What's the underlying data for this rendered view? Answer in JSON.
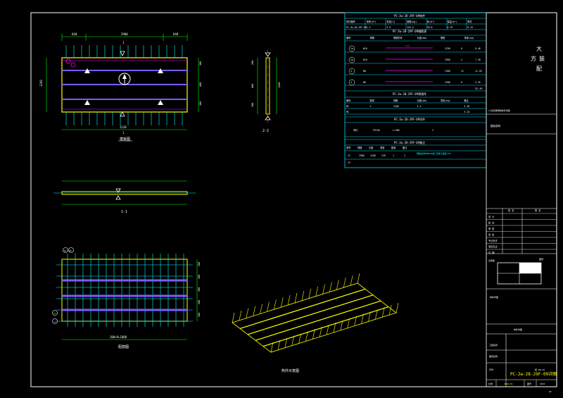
{
  "colors": {
    "frame": "#ffffff",
    "dim": "#00ff00",
    "table": "#00d7ff",
    "rebar": "#ffff00",
    "stirrup": "#00ffff",
    "beam": "#7b5cff",
    "cut": "#ff2020",
    "magenta": "#ff00ff",
    "text": "#ffffff",
    "title": "#ffff00"
  },
  "views": {
    "plan_label": "模板图",
    "side_label": "2-2",
    "section_label": "1-1",
    "rebar_plan_label": "配筋图",
    "iso_label": "构件示意图",
    "plan_dims": {
      "top_segments": [
        "640",
        "2900",
        "640"
      ],
      "bottom_total": "2120",
      "cut_mark": "1",
      "left_height": "1200",
      "right_vals": [
        "300",
        "600",
        "300"
      ]
    },
    "side_dims": [
      "200",
      "600",
      "200",
      "1200"
    ],
    "rebar_dims": {
      "bottom": "200×9=1800",
      "right": [
        "200",
        "200",
        "200",
        "200",
        "200"
      ]
    },
    "rebar_marks": [
      "1a",
      "2b",
      "3",
      "4"
    ]
  },
  "table": {
    "title": "PC-2w-28-29F-09构件",
    "header": [
      "构件编号",
      "体积(m³)",
      "重量(t)",
      "钢筋(kg)",
      "砼(m³)",
      "保温(m²)",
      "附件"
    ],
    "row": [
      "PC-2w-28-29F-09",
      "1.2",
      "2.9",
      "123.4",
      "95.0",
      "0.79",
      "0.15"
    ],
    "sub_title": "PC-2w-28-29F-09钢筋表",
    "sub_header": [
      "编号",
      "规格",
      "钢筋形状",
      "长度(mm)",
      "根数",
      "重量(kg)"
    ],
    "sub_rows": [
      [
        "1a",
        "Φ10",
        "1140",
        "2290",
        "6",
        "8.46"
      ],
      [
        "2b",
        "Φ10",
        "",
        "2960",
        "4",
        "7.30"
      ],
      [
        "3",
        "Φ8",
        "",
        "2380",
        "12",
        "11.28"
      ],
      [
        "4",
        "Φ8",
        "",
        "2300",
        "6",
        "5.45"
      ]
    ],
    "sub_total": "32.49",
    "embed_title": "PC-2w-28-29F-09预埋件",
    "embed_header": [
      "编号",
      "数量",
      "规格",
      "长度(mm)",
      "重量(kg)",
      "备注"
    ],
    "embed_rows": [
      [
        "M1",
        "2",
        "1200",
        "3.1",
        "",
        "4.16"
      ],
      [
        "M2",
        "",
        "",
        "",
        "",
        "5.24"
      ]
    ],
    "part_title": "PC-2w-28-29F-09吊件",
    "part_row": [
      "吊钉",
      "PVC40",
      "L=300",
      "",
      "2",
      "",
      ""
    ],
    "note_title": "PC-2w-28-29F-09备注",
    "note_header": [
      "型号",
      "规格",
      "长度",
      "重量",
      "数量",
      "备注"
    ],
    "note_rows": [
      [
        "J1",
        "2900",
        "1200",
        "120",
        "1",
        "1",
        "钢筋采用HRB400级,混凝土强度C30。"
      ],
      [
        "J2",
        "",
        "",
        "",
        "",
        "",
        ""
      ]
    ]
  },
  "titleblock": {
    "company": [
      "大",
      "方",
      "装",
      "配"
    ],
    "project_note": "xx住宅楼预制构件详图",
    "design_note": "图纸说明",
    "col_headers": [
      "姓 名",
      "签 名"
    ],
    "roles": [
      "设 计",
      "校 对",
      "审 核",
      "审 定",
      "专业负责",
      "项目负责",
      "日 期"
    ],
    "stamp_label": "注册章",
    "key_label": "图例",
    "dwg_type": "构件详图",
    "project_label": "工程名称",
    "sheet_label": "图纸名称",
    "drawing_title": "PC-2w-28-29F-09详图",
    "scale_label": "比例",
    "scale": "1:25",
    "sheet_no_label": "图号",
    "sheet_no": "2923",
    "version": "2019.01",
    "seq_label": "序号",
    "seq": "结-07",
    "page": "A2"
  }
}
